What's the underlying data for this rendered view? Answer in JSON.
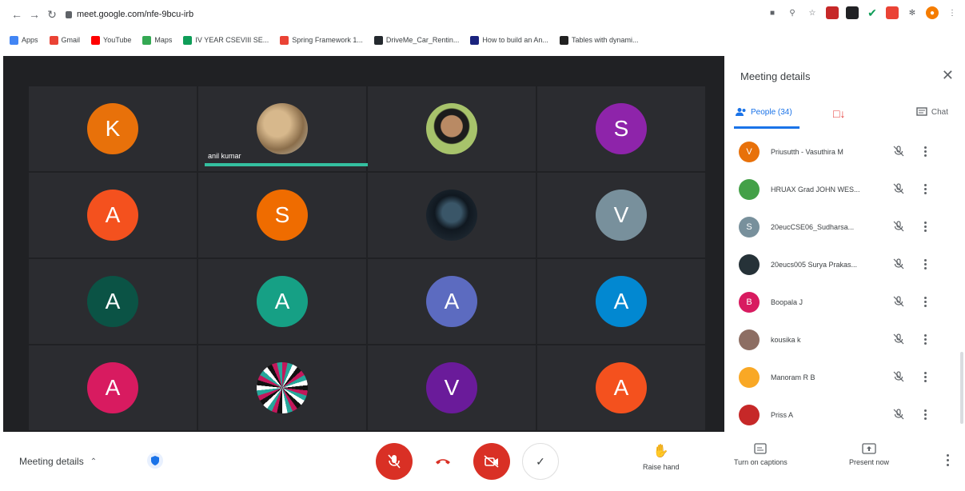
{
  "browser": {
    "url": "meet.google.com/nfe-9bcu-irb",
    "bookmarks": [
      {
        "label": "Apps",
        "color": "#4285f4"
      },
      {
        "label": "Gmail",
        "color": "#ea4335"
      },
      {
        "label": "YouTube",
        "color": "#ff0000"
      },
      {
        "label": "Maps",
        "color": "#34a853"
      },
      {
        "label": "IV YEAR CSEVIII SE...",
        "color": "#0f9d58"
      },
      {
        "label": "Spring Framework 1...",
        "color": "#ea4335"
      },
      {
        "label": "DriveMe_Car_Rentin...",
        "color": "#24292e"
      },
      {
        "label": "How to build an An...",
        "color": "#1a237e"
      },
      {
        "label": "Tables with dynami...",
        "color": "#212121"
      }
    ]
  },
  "stage": {
    "speaker_name": "anil kumar",
    "tiles": [
      {
        "kind": "letter",
        "letter": "K",
        "color": "#e8710a"
      },
      {
        "kind": "photo",
        "photo": "landscape",
        "speaking": true
      },
      {
        "kind": "photo",
        "photo": "portrait"
      },
      {
        "kind": "letter",
        "letter": "S",
        "color": "#8e24aa"
      },
      {
        "kind": "letter",
        "letter": "A",
        "color": "#f4511e"
      },
      {
        "kind": "letter",
        "letter": "S",
        "color": "#ef6c00"
      },
      {
        "kind": "photo",
        "photo": "dark-figure"
      },
      {
        "kind": "letter",
        "letter": "V",
        "color": "#78909c"
      },
      {
        "kind": "letter",
        "letter": "A",
        "color": "#0b5345"
      },
      {
        "kind": "letter",
        "letter": "A",
        "color": "#16a085"
      },
      {
        "kind": "letter",
        "letter": "A",
        "color": "#5c6bc0"
      },
      {
        "kind": "letter",
        "letter": "A",
        "color": "#0288d1"
      },
      {
        "kind": "letter",
        "letter": "A",
        "color": "#d81b60"
      },
      {
        "kind": "photo",
        "photo": "pattern"
      },
      {
        "kind": "letter",
        "letter": "V",
        "color": "#6a1b9a"
      },
      {
        "kind": "letter",
        "letter": "A",
        "color": "#f4511e"
      }
    ]
  },
  "panel": {
    "title": "Meeting details",
    "tab_people": "People (34)",
    "tab_chat": "Chat",
    "people": [
      {
        "name": "Priusutth - Vasuthira M",
        "initial": "V",
        "color": "#e8710a"
      },
      {
        "name": "HRUAX Grad JOHN WES...",
        "initial": "",
        "color": "#43a047"
      },
      {
        "name": "20eucCSE06_Sudharsa...",
        "initial": "S",
        "color": "#78909c"
      },
      {
        "name": "20eucs005 Surya Prakas...",
        "initial": "",
        "color": "#263238"
      },
      {
        "name": "Boopala J",
        "initial": "B",
        "color": "#d81b60"
      },
      {
        "name": "kousika k",
        "initial": "",
        "color": "#8d6e63"
      },
      {
        "name": "Manoram R B",
        "initial": "",
        "color": "#f9a825"
      },
      {
        "name": "Priss A",
        "initial": "",
        "color": "#c62828"
      }
    ]
  },
  "bottom": {
    "meeting_details": "Meeting details",
    "raise_hand": "Raise hand",
    "captions": "Turn on captions",
    "present": "Present now"
  },
  "colors": {
    "accent": "#1a73e8",
    "danger": "#d93025",
    "stage": "#202124",
    "speaking": "#34c0a0"
  }
}
